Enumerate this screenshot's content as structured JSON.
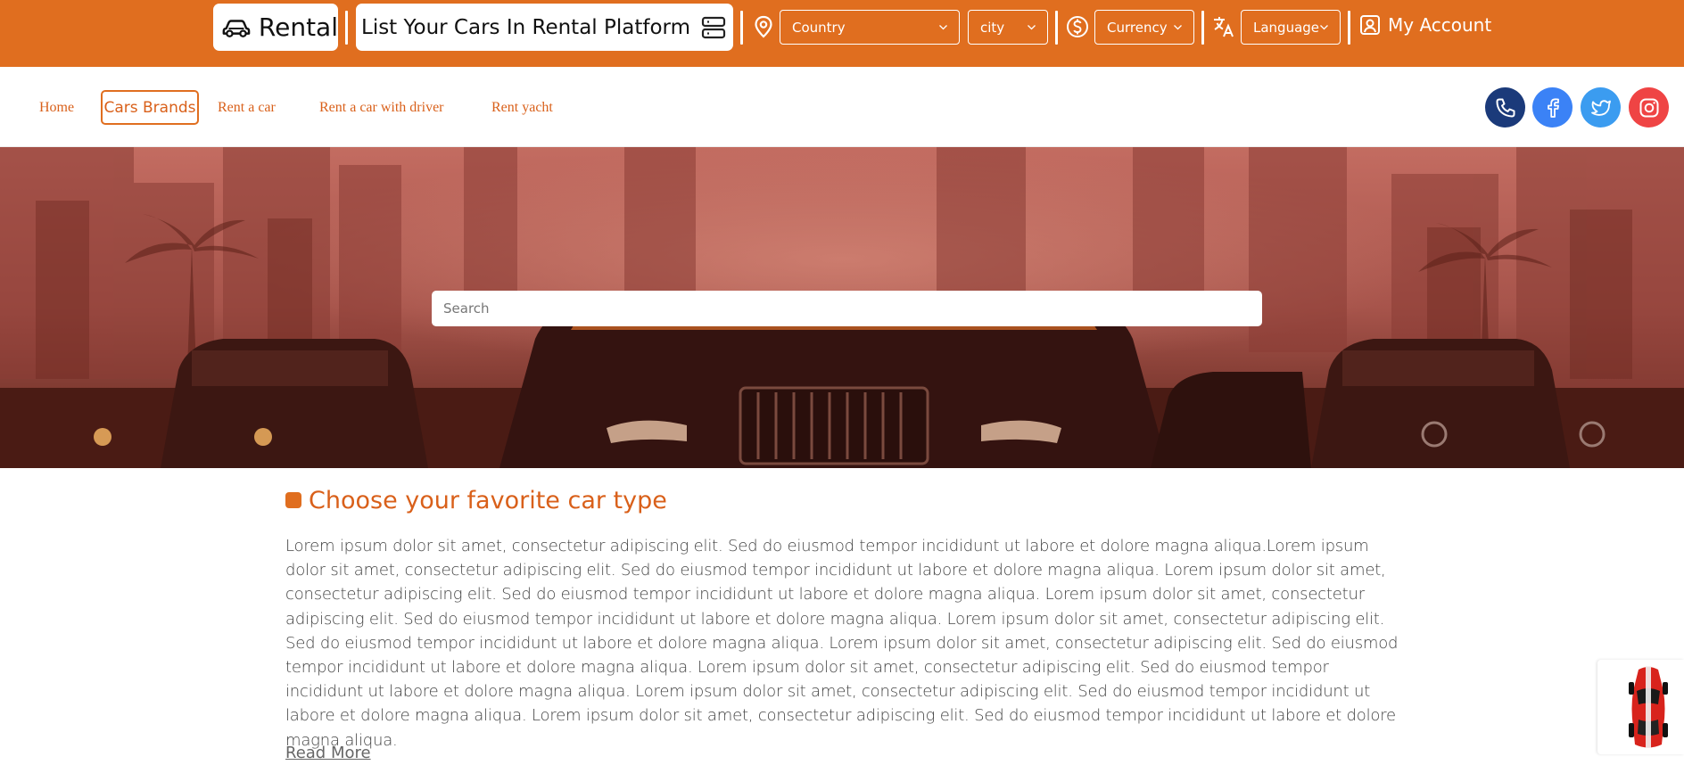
{
  "header": {
    "logo_text": "Rental",
    "list_cars_label": "List Your Cars In Rental Platform",
    "country_placeholder": "Country",
    "city_placeholder": "city",
    "currency_placeholder": "Currency",
    "language_placeholder": "Language",
    "account_label": "My Account",
    "brand_color": "#e06e1f"
  },
  "nav": {
    "items": [
      {
        "label": "Home"
      },
      {
        "label": "Cars Brands",
        "active": true
      },
      {
        "label": "Rent a car"
      },
      {
        "label": "Rent a car with driver"
      },
      {
        "label": "Rent yacht"
      }
    ],
    "social": [
      {
        "icon": "phone-icon",
        "color": "#1b3a7a"
      },
      {
        "icon": "facebook-icon",
        "color": "#3b82f6"
      },
      {
        "icon": "twitter-icon",
        "color": "#3b9cf0"
      },
      {
        "icon": "instagram-icon",
        "color": "#ef4444"
      }
    ]
  },
  "hero": {
    "search_placeholder": "Search"
  },
  "content": {
    "title": "Choose your favorite car type",
    "paragraph": "Lorem ipsum dolor sit amet, consectetur adipiscing elit. Sed do eiusmod tempor incididunt ut labore et dolore magna aliqua.Lorem ipsum dolor sit amet, consectetur adipiscing elit. Sed do eiusmod tempor incididunt ut labore et dolore magna aliqua. Lorem ipsum dolor sit amet, consectetur adipiscing elit. Sed do eiusmod tempor incididunt ut labore et dolore magna aliqua. Lorem ipsum dolor sit amet, consectetur adipiscing elit. Sed do eiusmod tempor incididunt ut labore et dolore magna aliqua. Lorem ipsum dolor sit amet, consectetur adipiscing elit. Sed do eiusmod tempor incididunt ut labore et dolore magna aliqua. Lorem ipsum dolor sit amet, consectetur adipiscing elit. Sed do eiusmod tempor incididunt ut labore et dolore magna aliqua. Lorem ipsum dolor sit amet, consectetur adipiscing elit. Sed do eiusmod tempor incididunt ut labore et dolore magna aliqua. Lorem ipsum dolor sit amet, consectetur adipiscing elit. Sed do eiusmod tempor incididunt ut labore et dolore magna aliqua. Lorem ipsum dolor sit amet, consectetur adipiscing elit. Sed do eiusmod tempor incididunt ut labore et dolore magna aliqua.",
    "read_more": "Read More"
  }
}
